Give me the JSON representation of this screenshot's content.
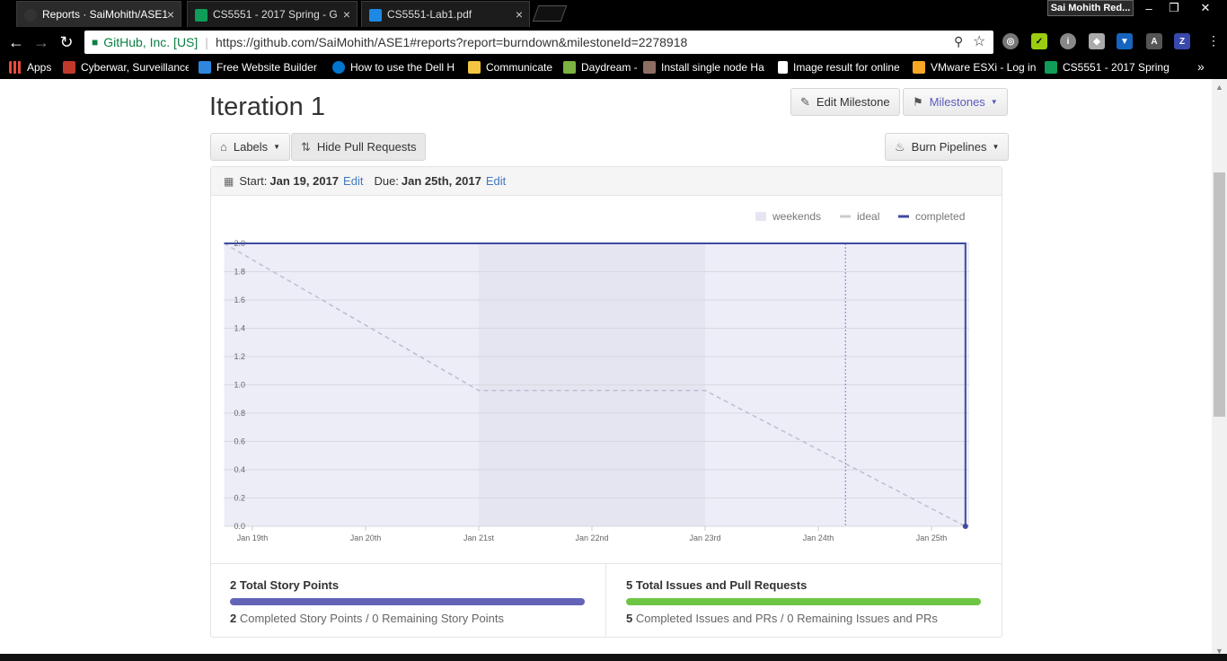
{
  "browser": {
    "tabs": [
      {
        "title": "Reports · SaiMohith/ASE1",
        "fav_color": "#333"
      },
      {
        "title": "CS5551 - 2017 Spring - G",
        "fav_color": "#0f9d58"
      },
      {
        "title": "CS5551-Lab1.pdf",
        "fav_color": "#1e88e5"
      }
    ],
    "profile": "Sai Mohith Red...",
    "window_buttons": [
      "–",
      "❐",
      "✕"
    ],
    "omnibox": {
      "org": "GitHub, Inc. [US]",
      "url": "https://github.com/SaiMohith/ASE1#reports?report=burndown&milestoneId=2278918"
    },
    "bookmarks": [
      {
        "label": "Apps",
        "color": "#e74c3c"
      },
      {
        "label": "Cyberwar, Surveillance",
        "color": "#c0392b"
      },
      {
        "label": "Free Website Builder |",
        "color": "#2e86de"
      },
      {
        "label": "How to use the Dell H",
        "color": "#0076ce"
      },
      {
        "label": "Communicate",
        "color": "#f5c542"
      },
      {
        "label": "Daydream -",
        "color": "#7cb342"
      },
      {
        "label": "Install single node Ha",
        "color": "#8d6e63"
      },
      {
        "label": "Image result for online",
        "color": "#ffffff"
      },
      {
        "label": "VMware ESXi - Log in",
        "color": "#f9a825"
      },
      {
        "label": "CS5551 - 2017 Spring",
        "color": "#0f9d58"
      }
    ],
    "more_bookmarks": "»"
  },
  "page": {
    "title": "Iteration 1",
    "buttons": {
      "edit_milestone": "Edit Milestone",
      "milestones": "Milestones",
      "labels": "Labels",
      "hide_prs": "Hide Pull Requests",
      "burn_pipelines": "Burn Pipelines"
    },
    "dates": {
      "start_label": "Start:",
      "start": "Jan 19, 2017",
      "due_label": "Due:",
      "due": "Jan 25th, 2017",
      "edit": "Edit"
    },
    "stats": {
      "points_title": "2 Total Story Points",
      "points_completed": "2",
      "points_completed_label": "Completed Story Points",
      "points_remaining": "/ 0 Remaining Story Points",
      "points_fraction": 1.0,
      "points_color": "#6364b8",
      "issues_title": "5 Total Issues and Pull Requests",
      "issues_completed": "5",
      "issues_completed_label": "Completed Issues and PRs",
      "issues_remaining": "/ 0 Remaining Issues and PRs",
      "issues_fraction": 1.0,
      "issues_color": "#6cc644"
    }
  },
  "chart_data": {
    "type": "line",
    "legend": [
      {
        "name": "weekends",
        "color": "#e6e6f2"
      },
      {
        "name": "ideal",
        "color": "#cccccc"
      },
      {
        "name": "completed",
        "color": "#3f4aa0"
      }
    ],
    "legend_position": "top-right",
    "x_ticks": [
      "Jan 19th",
      "Jan 20th",
      "Jan 21st",
      "Jan 22nd",
      "Jan 23rd",
      "Jan 24th",
      "Jan 25th"
    ],
    "y_ticks": [
      "0.0",
      "0.2",
      "0.4",
      "0.6",
      "0.8",
      "1.0",
      "1.2",
      "1.4",
      "1.6",
      "1.8",
      "2.0"
    ],
    "ylim": [
      0,
      2
    ],
    "xlim_days": [
      0,
      6.3
    ],
    "weekend_range_days": [
      2,
      4
    ],
    "today_day": 5.24,
    "series": [
      {
        "name": "ideal",
        "x_days": [
          -0.25,
          2,
          4,
          6.3
        ],
        "y": [
          2,
          0.96,
          0.96,
          0
        ]
      },
      {
        "name": "completed",
        "x_days": [
          -0.25,
          6.3,
          6.3
        ],
        "y": [
          2,
          2,
          0
        ]
      }
    ],
    "grid": true,
    "colors": {
      "plot_bg": "#ededf7",
      "weekend_bg": "#e4e5f1",
      "grid": "#d8d8e0"
    }
  }
}
